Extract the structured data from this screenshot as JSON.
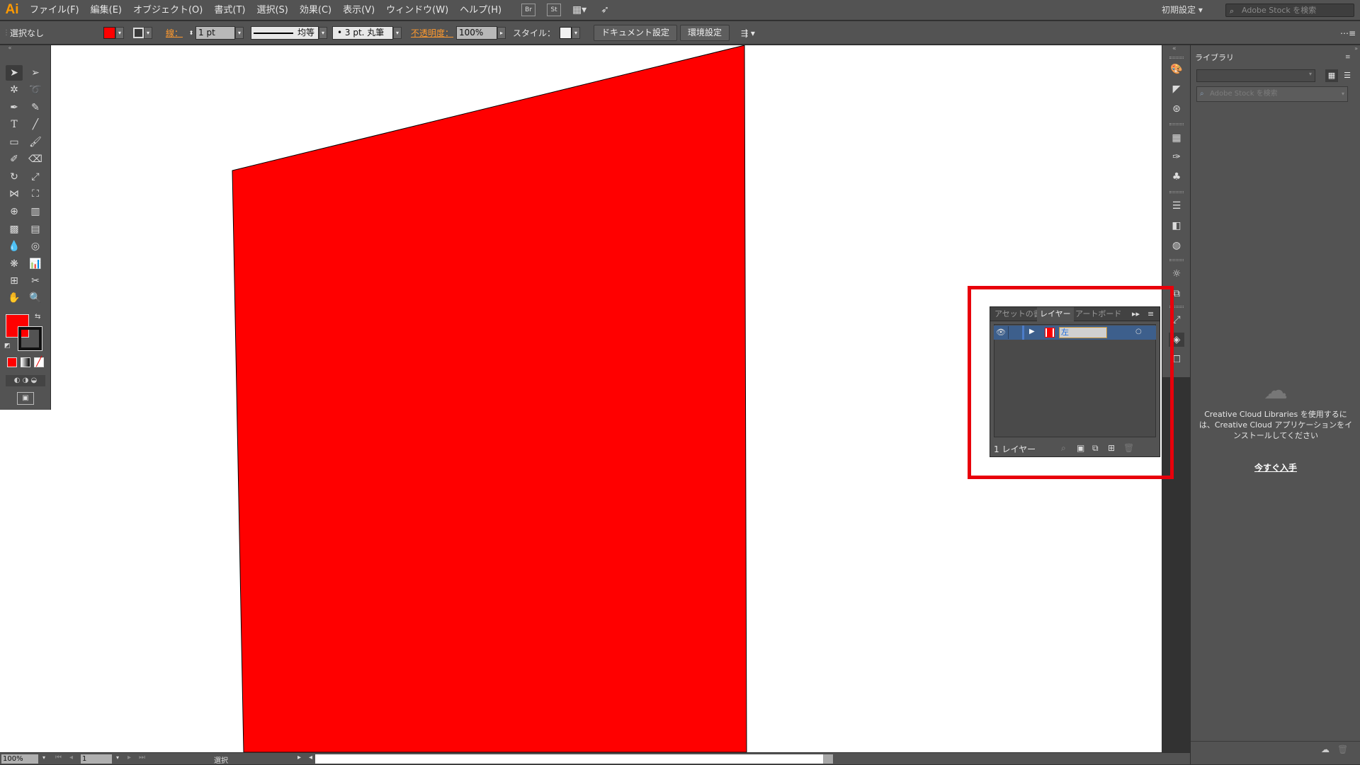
{
  "app": {
    "logo": "Ai"
  },
  "menu": [
    "ファイル(F)",
    "編集(E)",
    "オブジェクト(O)",
    "書式(T)",
    "選択(S)",
    "効果(C)",
    "表示(V)",
    "ウィンドウ(W)",
    "ヘルプ(H)"
  ],
  "menu_icons": [
    "Br",
    "St"
  ],
  "workspace": "初期設定 ▾",
  "stock_search_placeholder": "Adobe Stock を検索",
  "control": {
    "selection": "選択なし",
    "fill_color": "#ff0000",
    "stroke_label": "線：",
    "stroke_weight": "1 pt",
    "stroke_profile": "均等",
    "brush": "3 pt. 丸筆",
    "opacity_label": "不透明度：",
    "opacity": "100%",
    "style_label": "スタイル：",
    "doc_settings": "ドキュメント設定",
    "preferences": "環境設定"
  },
  "layers_panel": {
    "tabs": [
      "アセットの書",
      "レイヤー",
      "アートボード"
    ],
    "active_tab": "レイヤー",
    "layer_name": "左",
    "layer_color": "#ff0000",
    "count": "1 レイヤー"
  },
  "library": {
    "tab": "ライブラリ",
    "search_placeholder": "Adobe Stock を検索",
    "message": "Creative Cloud Libraries を使用するには、Creative Cloud アプリケーションをインストールしてください",
    "link": "今すぐ入手"
  },
  "status": {
    "zoom": "100%",
    "artboard": "1",
    "tool": "選択"
  },
  "artwork": {
    "shape_color": "#ff0000"
  },
  "colors": {
    "accent_orange": "#ff9a2e",
    "highlight_red": "#e8000b",
    "ui_gray": "#535353"
  }
}
